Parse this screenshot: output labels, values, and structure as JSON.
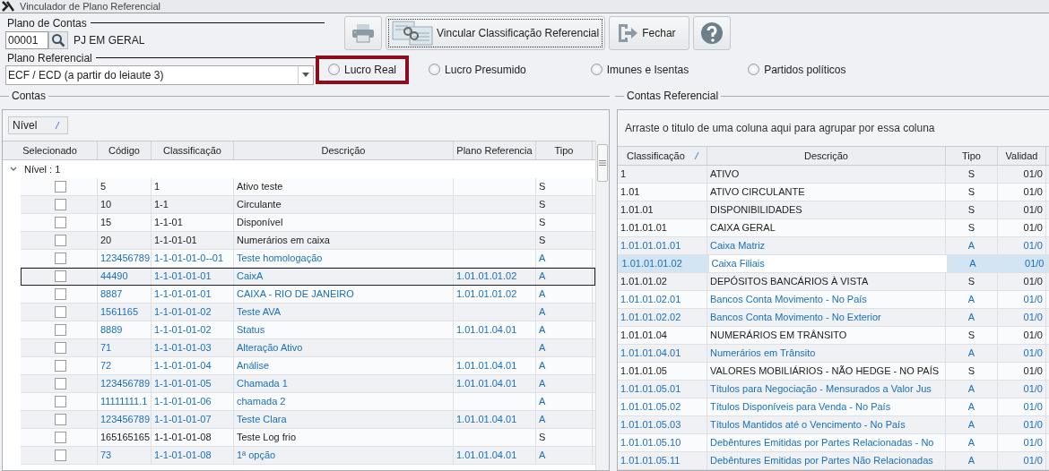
{
  "window": {
    "title": "Vinculador de Plano Referencial"
  },
  "plano_de_contas": {
    "label": "Plano de Contas",
    "code": "00001",
    "name": "PJ EM GERAL"
  },
  "plano_referencial": {
    "label": "Plano Referencial",
    "value": "ECF / ECD (a partir do leiaute 3)"
  },
  "toolbar": {
    "link_button": "Vincular Classificação Referencial",
    "close_button": "Fechar"
  },
  "regimes": [
    {
      "label": "Lucro Real",
      "selected": false,
      "highlighted": true
    },
    {
      "label": "Lucro Presumido",
      "selected": false,
      "highlighted": false
    },
    {
      "label": "Imunes e Isentas",
      "selected": false,
      "highlighted": false
    },
    {
      "label": "Partidos políticos",
      "selected": false,
      "highlighted": false
    }
  ],
  "contas": {
    "title": "Contas",
    "group_chip": "Nível",
    "selection_column": "Selecionado",
    "columns": [
      "Código",
      "Classificação",
      "Descrição",
      "Plano Referencia",
      "Tipo"
    ],
    "group_row": "Nível : 1",
    "rows": [
      {
        "kind": "synthetic",
        "checked": false,
        "focused": false,
        "cells": [
          "5",
          "1",
          "Ativo  teste",
          "",
          "S"
        ]
      },
      {
        "kind": "synthetic",
        "checked": false,
        "focused": false,
        "cells": [
          "10",
          "1-1",
          "Circulante",
          "",
          "S"
        ]
      },
      {
        "kind": "synthetic",
        "checked": false,
        "focused": false,
        "cells": [
          "15",
          "1-1-01",
          "Disponível",
          "",
          "S"
        ]
      },
      {
        "kind": "synthetic",
        "checked": false,
        "focused": false,
        "cells": [
          "20",
          "1-1-01-01",
          "Numerários em caixa",
          "",
          "S"
        ]
      },
      {
        "kind": "analytic",
        "checked": false,
        "focused": false,
        "cells": [
          "123456789",
          "1-1-01-01-0--01",
          "Teste homologação",
          "",
          "A"
        ]
      },
      {
        "kind": "analytic",
        "checked": false,
        "focused": true,
        "cells": [
          "44490",
          "1-1-01-01-01",
          "CaixA",
          "1.01.01.01.02",
          "A"
        ]
      },
      {
        "kind": "analytic",
        "checked": false,
        "focused": false,
        "cells": [
          "8887",
          "1-1-01-01-01",
          "CAIXA - RIO DE JANEIRO",
          "1.01.01.01.02",
          "A"
        ]
      },
      {
        "kind": "analytic",
        "checked": false,
        "focused": false,
        "cells": [
          "1561165",
          "1-1-01-01-02",
          "Teste AVA",
          "",
          "A"
        ]
      },
      {
        "kind": "analytic",
        "checked": false,
        "focused": false,
        "cells": [
          "8889",
          "1-1-01-01-02",
          "Status",
          "1.01.01.04.01",
          "A"
        ]
      },
      {
        "kind": "analytic",
        "checked": false,
        "focused": false,
        "cells": [
          "71",
          "1-1-01-01-03",
          "Alteração Ativo",
          "",
          "A"
        ]
      },
      {
        "kind": "analytic",
        "checked": false,
        "focused": false,
        "cells": [
          "72",
          "1-1-01-01-04",
          "Análise",
          "1.01.01.04.01",
          "A"
        ]
      },
      {
        "kind": "analytic",
        "checked": false,
        "focused": false,
        "cells": [
          "123456789",
          "1-1-01-01-05",
          "Chamada 1",
          "1.01.01.04.01",
          "A"
        ]
      },
      {
        "kind": "analytic",
        "checked": false,
        "focused": false,
        "cells": [
          "11111111.1",
          "1-1-01-01-06",
          "chamada 2",
          "",
          "A"
        ]
      },
      {
        "kind": "analytic",
        "checked": false,
        "focused": false,
        "cells": [
          "123456789",
          "1-1-01-01-07",
          "Teste Clara",
          "1.01.01.04.01",
          "A"
        ]
      },
      {
        "kind": "synthetic",
        "checked": false,
        "focused": false,
        "cells": [
          "165165165",
          "1-1-01-01-08",
          "Teste Log frio",
          "",
          "S"
        ]
      },
      {
        "kind": "analytic",
        "checked": false,
        "focused": false,
        "cells": [
          "73",
          "1-1-01-01-08",
          "1ª opção",
          "1.01.01.04.01",
          "A"
        ]
      }
    ]
  },
  "contas_referencial": {
    "title": "Contas Referencial",
    "group_hint": "Arraste o titulo de uma coluna aqui para agrupar por essa coluna",
    "columns": [
      "Classificação",
      "Descrição",
      "Tipo",
      "Validad"
    ],
    "rows": [
      {
        "kind": "synthetic",
        "selected": false,
        "cells": [
          "1",
          "ATIVO",
          "S",
          "01/0"
        ]
      },
      {
        "kind": "synthetic",
        "selected": false,
        "cells": [
          "1.01",
          "ATIVO CIRCULANTE",
          "S",
          "01/0"
        ]
      },
      {
        "kind": "synthetic",
        "selected": false,
        "cells": [
          "1.01.01",
          "DISPONIBILIDADES",
          "S",
          "01/0"
        ]
      },
      {
        "kind": "synthetic",
        "selected": false,
        "cells": [
          "1.01.01.01",
          "CAIXA GERAL",
          "S",
          "01/0"
        ]
      },
      {
        "kind": "analytic",
        "selected": false,
        "cells": [
          "1.01.01.01.01",
          "Caixa Matriz",
          "A",
          "01/0"
        ]
      },
      {
        "kind": "analytic",
        "selected": true,
        "cells": [
          "1.01.01.01.02",
          "Caixa Filiais",
          "A",
          "01/0"
        ]
      },
      {
        "kind": "synthetic",
        "selected": false,
        "cells": [
          "1.01.01.02",
          "DEPÓSITOS BANCÁRIOS À VISTA",
          "S",
          "01/0"
        ]
      },
      {
        "kind": "analytic",
        "selected": false,
        "cells": [
          "1.01.01.02.01",
          "Bancos Conta Movimento - No País",
          "A",
          "01/0"
        ]
      },
      {
        "kind": "analytic",
        "selected": false,
        "cells": [
          "1.01.01.02.02",
          "Bancos Conta Movimento - No Exterior",
          "A",
          "01/0"
        ]
      },
      {
        "kind": "synthetic",
        "selected": false,
        "cells": [
          "1.01.01.04",
          "NUMERÁRIOS EM TRÂNSITO",
          "S",
          "01/0"
        ]
      },
      {
        "kind": "analytic",
        "selected": false,
        "cells": [
          "1.01.01.04.01",
          "Numerários em Trânsito",
          "A",
          "01/0"
        ]
      },
      {
        "kind": "synthetic",
        "selected": false,
        "cells": [
          "1.01.01.05",
          "VALORES MOBILIÁRIOS - NÃO HEDGE - NO PAÍS",
          "S",
          "01/0"
        ]
      },
      {
        "kind": "analytic",
        "selected": false,
        "cells": [
          "1.01.01.05.01",
          "Títulos para Negociação - Mensurados a Valor Jus",
          "A",
          "01/0"
        ]
      },
      {
        "kind": "analytic",
        "selected": false,
        "cells": [
          "1.01.01.05.02",
          "Títulos Disponíveis para Venda - No País",
          "A",
          "01/0"
        ]
      },
      {
        "kind": "analytic",
        "selected": false,
        "cells": [
          "1.01.01.05.03",
          "Títulos Mantidos até o Vencimento - No País",
          "A",
          "01/0"
        ]
      },
      {
        "kind": "analytic",
        "selected": false,
        "cells": [
          "1.01.01.05.10",
          "Debêntures Emitidas por Partes Relacionadas - No",
          "A",
          "01/0"
        ]
      },
      {
        "kind": "analytic",
        "selected": false,
        "cells": [
          "1.01.01.05.11",
          "Debêntures Emitidas por Partes Não Relacionadas",
          "A",
          "01/0"
        ]
      }
    ]
  }
}
